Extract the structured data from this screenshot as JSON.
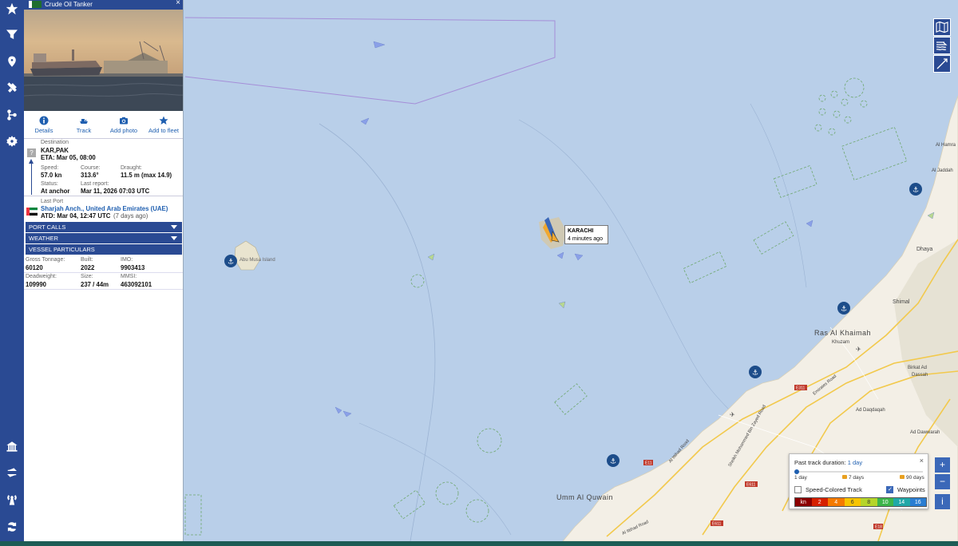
{
  "vessel": {
    "type_label": "Crude Oil Tanker",
    "close": "×",
    "actions": [
      {
        "label": "Details",
        "icon": "info-icon"
      },
      {
        "label": "Track",
        "icon": "ship-track-icon"
      },
      {
        "label": "Add photo",
        "icon": "camera-icon"
      },
      {
        "label": "Add to fleet",
        "icon": "star-icon"
      }
    ],
    "destination_label": "Destination",
    "destination_value": "KAR,PAK",
    "eta": "ETA: Mar 05, 08:00",
    "unknown_mark": "?",
    "speed_label": "Speed:",
    "speed_value": "57.0 kn",
    "course_label": "Course:",
    "course_value": "313.6°",
    "draught_label": "Draught:",
    "draught_value": "11.5 m (max 14.9)",
    "status_label": "Status:",
    "status_value": "At anchor",
    "last_report_label": "Last report:",
    "last_report_value": "Mar 11, 2026 07:03 UTC",
    "last_port_label": "Last Port",
    "last_port_value": "Sharjah Anch., United Arab Emirates (UAE)",
    "atd": "ATD: Mar 04, 12:47 UTC",
    "atd_ago": "(7 days ago)",
    "sections": [
      "PORT CALLS",
      "WEATHER",
      "VESSEL PARTICULARS"
    ],
    "gross_tonnage_label": "Gross Tonnage:",
    "gross_tonnage_value": "60120",
    "built_label": "Built:",
    "built_value": "2022",
    "imo_label": "IMO:",
    "imo_value": "9903413",
    "deadweight_label": "Deadweight:",
    "deadweight_value": "109990",
    "size_label": "Size:",
    "size_value": "237 / 44m",
    "mmsi_label": "MMSI:",
    "mmsi_value": "463092101"
  },
  "map": {
    "popup_name": "KARACHI",
    "popup_time": "4 minutes ago",
    "places": [
      "Abu Musa Island",
      "Ras Al Khaimah",
      "Umm Al Quwain",
      "Shimal",
      "Dhaya",
      "Khuzam",
      "Birkat Ad Dassah",
      "Ad Daqdaqah",
      "Ad Dawwarah",
      "Al Jaddah",
      "Al Hamra",
      "Emirates Road",
      "Sheikh Mohammed Bin Zayed Road",
      "Al Ittihad Road",
      "E611",
      "E311",
      "E18",
      "E11"
    ]
  },
  "track_panel": {
    "title": "Past track duration:",
    "title_value": "1 day",
    "close": "×",
    "options": [
      "1 day",
      "7 days",
      "90 days"
    ],
    "speed_colored": "Speed-Colored Track",
    "waypoints": "Waypoints",
    "speed_units": "kn",
    "speed_scale": [
      "2",
      "4",
      "6",
      "8",
      "10",
      "14",
      "16"
    ],
    "speed_colors": [
      "#8b0000",
      "#d62000",
      "#f57a00",
      "#f7c400",
      "#b5d52a",
      "#3db54a",
      "#20a8a8",
      "#2a7dd2"
    ]
  },
  "controls": {
    "zoom_in": "+",
    "zoom_out": "−",
    "info": "i"
  },
  "colors": {
    "sea": "#b9cfe9",
    "land": "#f3efe6",
    "nav": "#2a4a93"
  }
}
